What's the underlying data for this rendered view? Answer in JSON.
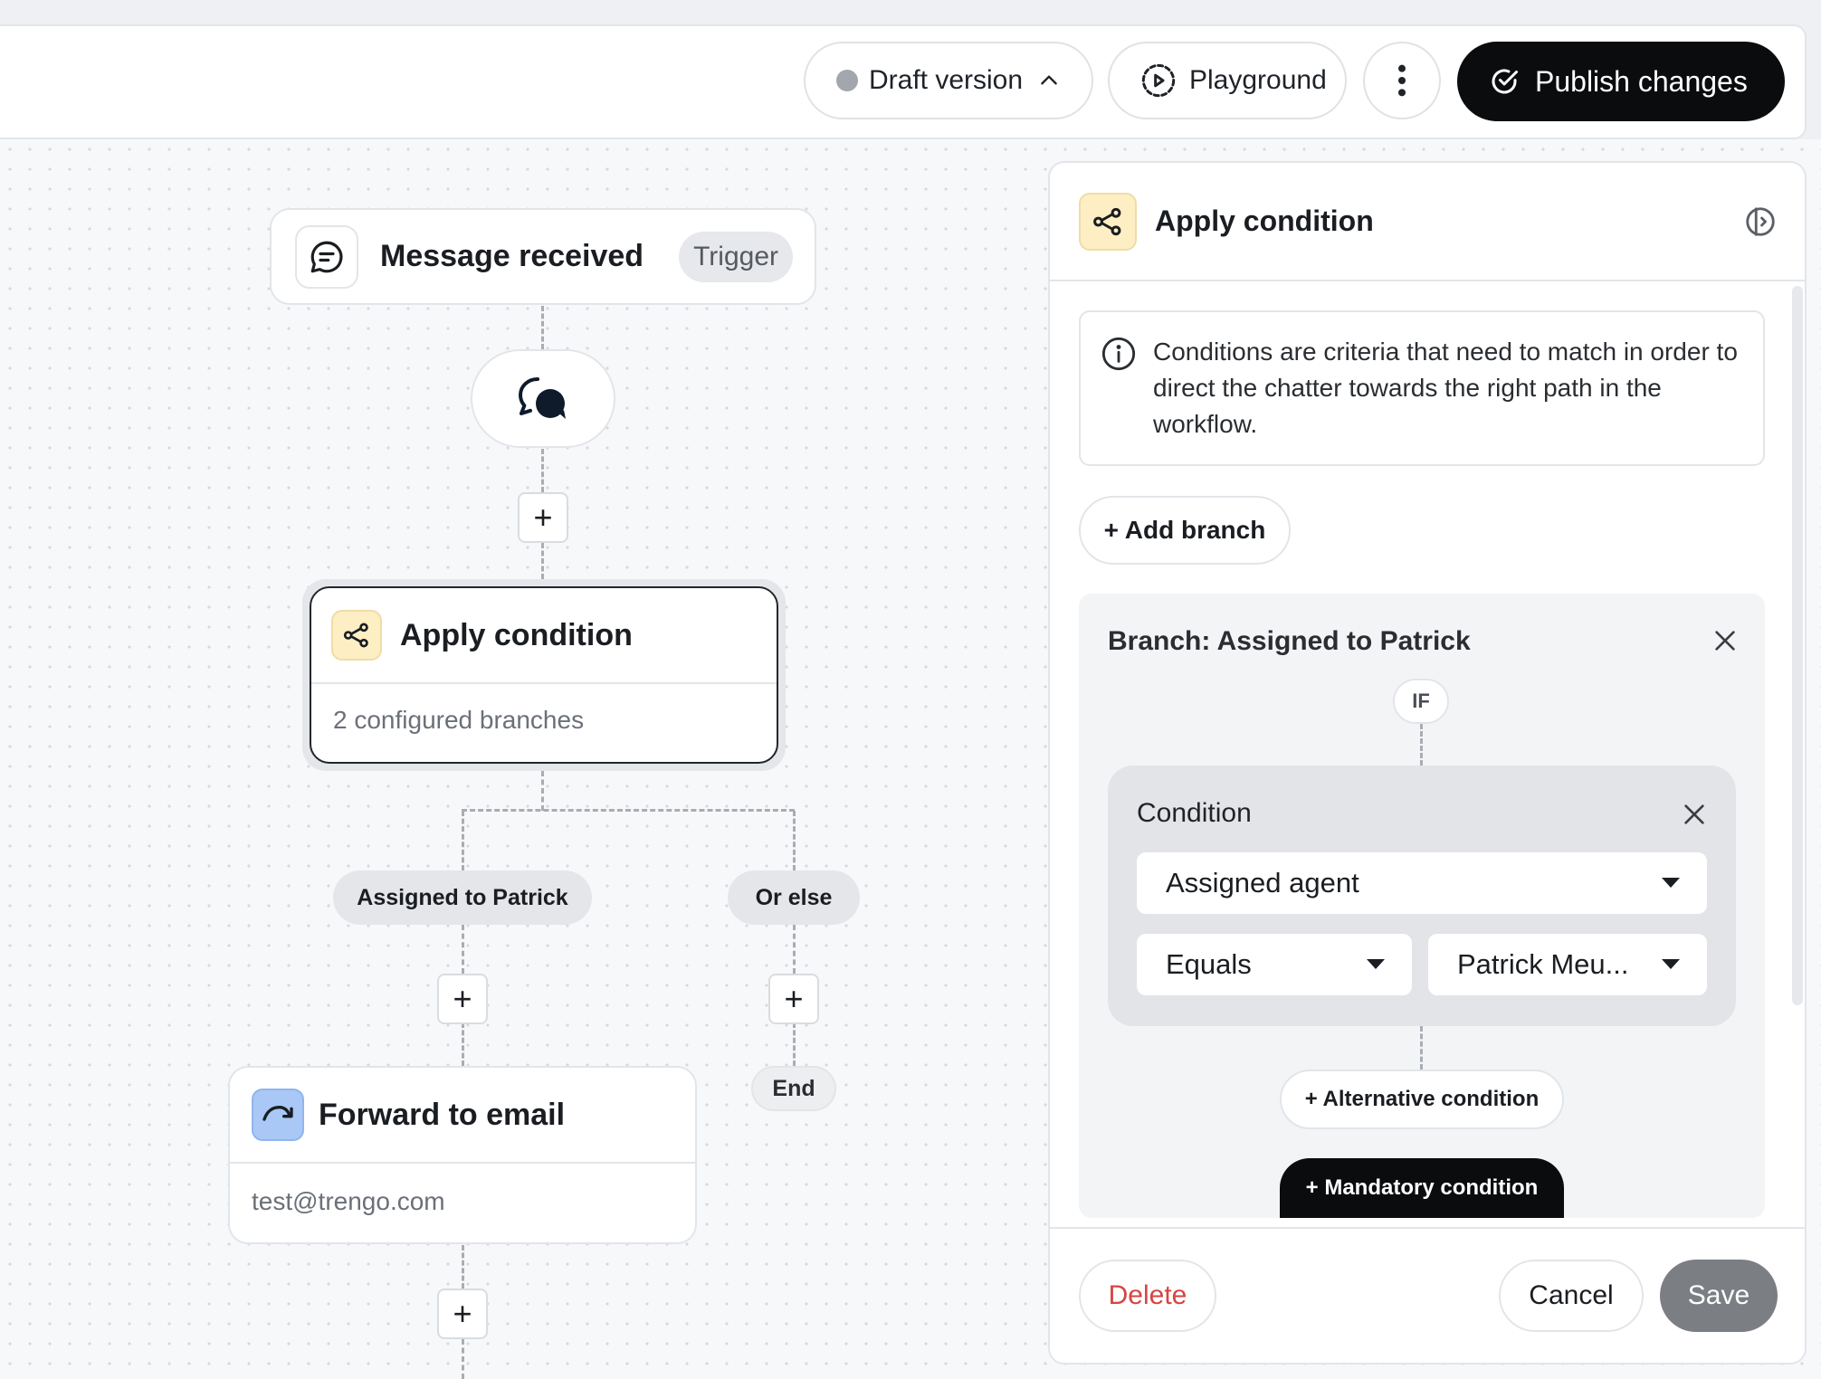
{
  "toolbar": {
    "draft_label": "Draft version",
    "playground_label": "Playground",
    "publish_label": "Publish changes"
  },
  "canvas": {
    "trigger_node": {
      "title": "Message received",
      "badge": "Trigger"
    },
    "condition_node": {
      "title": "Apply condition",
      "subtitle": "2 configured branches"
    },
    "branches": [
      {
        "label": "Assigned to Patrick"
      },
      {
        "label": "Or else"
      }
    ],
    "end_label": "End",
    "forward_node": {
      "title": "Forward to email",
      "subtitle": "test@trengo.com"
    },
    "add_step_label": "+"
  },
  "panel": {
    "title": "Apply condition",
    "info_text": "Conditions are criteria that need to match in order to direct the chatter towards the right path in the workflow.",
    "add_branch_label": "+ Add branch",
    "branch": {
      "title": "Branch: Assigned to Patrick",
      "if_label": "IF",
      "condition": {
        "title": "Condition",
        "field_value": "Assigned agent",
        "operator_value": "Equals",
        "value": "Patrick Meu..."
      },
      "alternative_label": "+ Alternative condition",
      "mandatory_label": "+ Mandatory condition"
    },
    "footer": {
      "delete_label": "Delete",
      "cancel_label": "Cancel",
      "save_label": "Save"
    }
  },
  "icons": {
    "trigger": "chat-bubble-icon",
    "channel": "chat-bubbles-icon",
    "condition": "branch-icon",
    "forward": "forward-arrow-icon",
    "info": "info-icon",
    "close": "close-icon",
    "panel_toggle": "panel-collapse-icon",
    "playground": "play-circle-icon",
    "publish": "check-circle-icon"
  },
  "colors": {
    "primary": "#0b0c0e",
    "condition_icon_bg": "#fdeec4",
    "forward_icon_bg": "#a9c8f5",
    "delete_text": "#d64541",
    "save_disabled": "#7b7e83"
  }
}
